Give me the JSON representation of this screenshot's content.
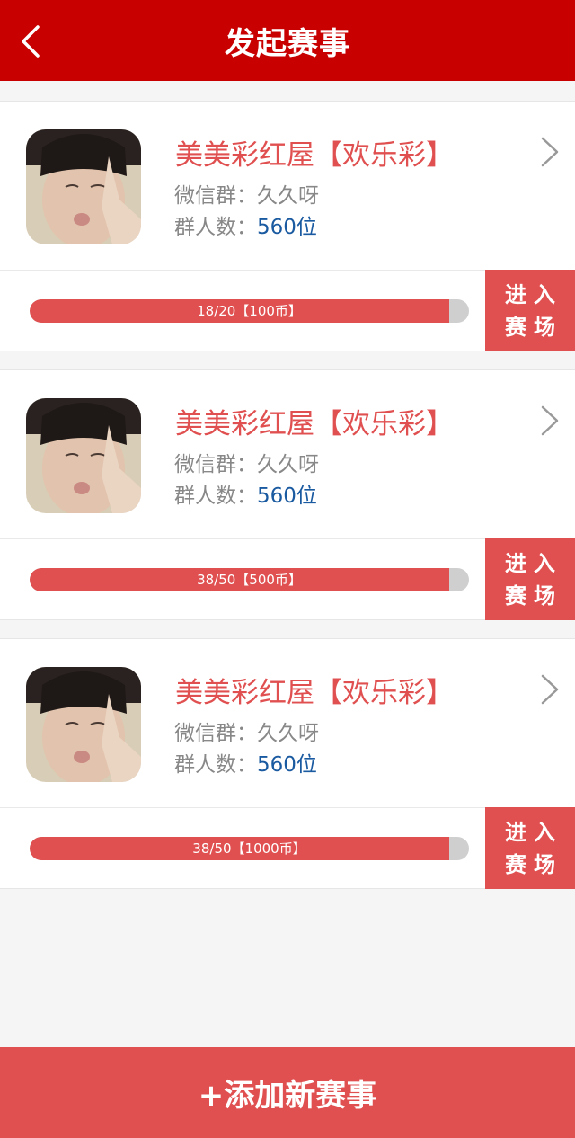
{
  "header": {
    "title": "发起赛事",
    "back_icon": "chevron-left-icon"
  },
  "colors": {
    "header_bg": "#c80000",
    "accent": "#e05050",
    "link_blue": "#1a5aa0"
  },
  "events": [
    {
      "name": "美美彩红屋【欢乐彩】",
      "wechat_label": "微信群：",
      "wechat_value": "久久呀",
      "members_label": "群人数：",
      "members_value": "560位",
      "progress_text": "18/20【100币】",
      "progress": 0.955,
      "enter_line1": "进入",
      "enter_line2": "赛场"
    },
    {
      "name": "美美彩红屋【欢乐彩】",
      "wechat_label": "微信群：",
      "wechat_value": "久久呀",
      "members_label": "群人数：",
      "members_value": "560位",
      "progress_text": "38/50【500币】",
      "progress": 0.955,
      "enter_line1": "进入",
      "enter_line2": "赛场"
    },
    {
      "name": "美美彩红屋【欢乐彩】",
      "wechat_label": "微信群：",
      "wechat_value": "久久呀",
      "members_label": "群人数：",
      "members_value": "560位",
      "progress_text": "38/50【1000币】",
      "progress": 0.955,
      "enter_line1": "进入",
      "enter_line2": "赛场"
    }
  ],
  "footer": {
    "add_label": "+添加新赛事"
  }
}
